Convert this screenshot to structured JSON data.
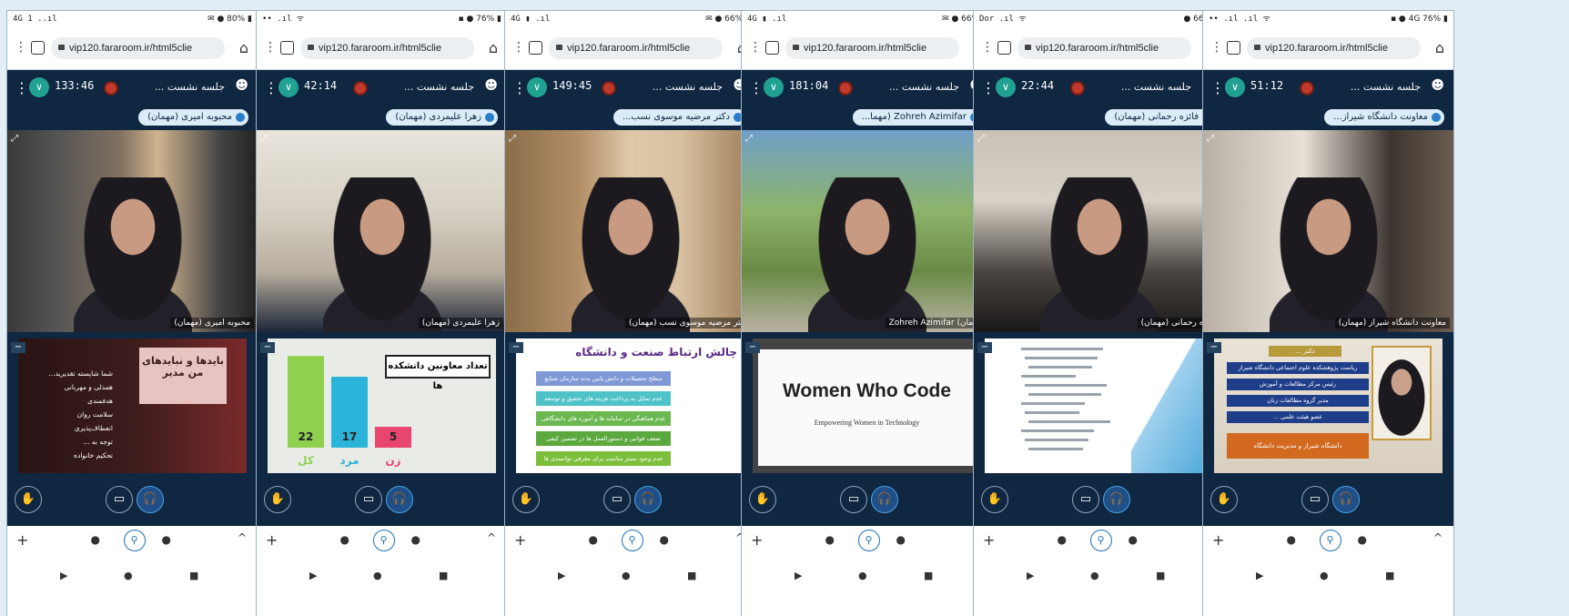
{
  "phones": [
    {
      "status": {
        "left": "4G 1 ..ıl",
        "right": "✉ ● 80% ▮"
      },
      "url": "vip120.fararoom.ir/html5clie",
      "timer": "133:46",
      "session": "جلسه نشست ...",
      "presenter": "محبوبه امیری (مهمان)",
      "video_caption": "محبوبه امیری (مهمان)",
      "slide": {
        "kind": "pink",
        "title": "بایدها و نبایدهای من مدیر",
        "lines": [
          "شما شایسته تقدیرید...",
          "همدلی و مهربانی",
          "هدفمندی",
          "سلامت روان",
          "انعطاف‌پذیری",
          "توجه به ...",
          "تحکیم خانواده"
        ]
      }
    },
    {
      "status": {
        "left": "•• .ıl ᯤ",
        "right": "▪ ● 76% ▮"
      },
      "url": "vip120.fararoom.ir/html5clie",
      "timer": "42:14",
      "session": "جلسه نشست ...",
      "presenter": "زهرا علیمردی (مهمان)",
      "video_caption": "زهرا علیمردی (مهمان)",
      "slide": {
        "kind": "bars",
        "title": "تعداد معاونین دانشکده ها",
        "bars": [
          {
            "label": "زن",
            "value": 5,
            "color": "#e8456f"
          },
          {
            "label": "مرد",
            "value": 17,
            "color": "#2bb4d9"
          },
          {
            "label": "کل",
            "value": 22,
            "color": "#8fd14f"
          }
        ]
      }
    },
    {
      "status": {
        "left": "4G ▮ .ıl",
        "right": "✉ ● 66% ▮"
      },
      "url": "vip120.fararoom.ir/html5clie",
      "timer": "149:45",
      "session": "جلسه نشست ...",
      "presenter": "دکتر مرضیه موسوی نسب...",
      "video_caption": "دکتر مرضیه موسوی نسب (مهمان)",
      "slide": {
        "kind": "list",
        "title": "چالش ارتباط صنعت و دانشگاه",
        "items": [
          {
            "text": "سطح تحصیلات و دانش پایین بدنه سازمان صنایع",
            "color": "#7f98d6"
          },
          {
            "text": "عدم تمایل به پرداخت هزینه های تحقیق و توسعه",
            "color": "#4fc2c7"
          },
          {
            "text": "عدم هماهنگی در سامانه ها و آموزه های دانشگاهی",
            "color": "#6ab84f"
          },
          {
            "text": "ضعف قوانین و دستورالعمل ها در تضمین کیفی",
            "color": "#5aa83e"
          },
          {
            "text": "عدم وجود بستر مناسب برای معرفی توانمندی ها",
            "color": "#7dbf3b"
          }
        ]
      }
    },
    {
      "status": {
        "left": "4G ▮ .ıl",
        "right": "✉ ● 66% ▮"
      },
      "url": "vip120.fararoom.ir/html5clie",
      "timer": "181:04",
      "session": "جلسه نشست ...",
      "presenter": "Zohreh Azimifar (مهما...",
      "video_caption": "(مهمان) Zohreh Azimifar",
      "slide": {
        "kind": "wwc",
        "title": "Women Who Code",
        "subtitle": "Empowering Women in Technology"
      }
    },
    {
      "status": {
        "left": "Dor .ıl ᯤ",
        "right": "● 66% ▮"
      },
      "url": "vip120.fararoom.ir/html5clie",
      "timer": "22:44",
      "session": "جلسه نشست ...",
      "presenter": "فائزه رحمانی (مهمان)",
      "video_caption": "فائزه رحمانی (مهمان)",
      "slide": {
        "kind": "doc"
      }
    },
    {
      "status": {
        "left": "•• .ıl .ıl ᯤ",
        "right": "▪ ● 4G 76% ▮"
      },
      "url": "vip120.fararoom.ir/html5clie",
      "timer": "51:12",
      "session": "جلسه نشست ...",
      "presenter": "معاونت دانشگاه شیراز...",
      "video_caption": "معاونت دانشگاه شیراز (مهمان)",
      "slide": {
        "kind": "profile",
        "name": "دکتر ...",
        "lines": [
          "ریاست پژوهشکده علوم اجتماعی دانشگاه شیراز",
          "رئیس مرکز مطالعات و آموزش",
          "مدیر گروه مطالعات زنان",
          "عضو هیئت علمی ..."
        ],
        "footer": "دانشگاه شیراز و مدیریت دانشگاه"
      }
    }
  ],
  "controls": {
    "hand": "✋",
    "video": "▭",
    "audio": "🎧",
    "mic": "🎤"
  },
  "bottom": {
    "plus": "+",
    "up": "^",
    "nav": [
      "▶",
      "●",
      "■"
    ]
  }
}
